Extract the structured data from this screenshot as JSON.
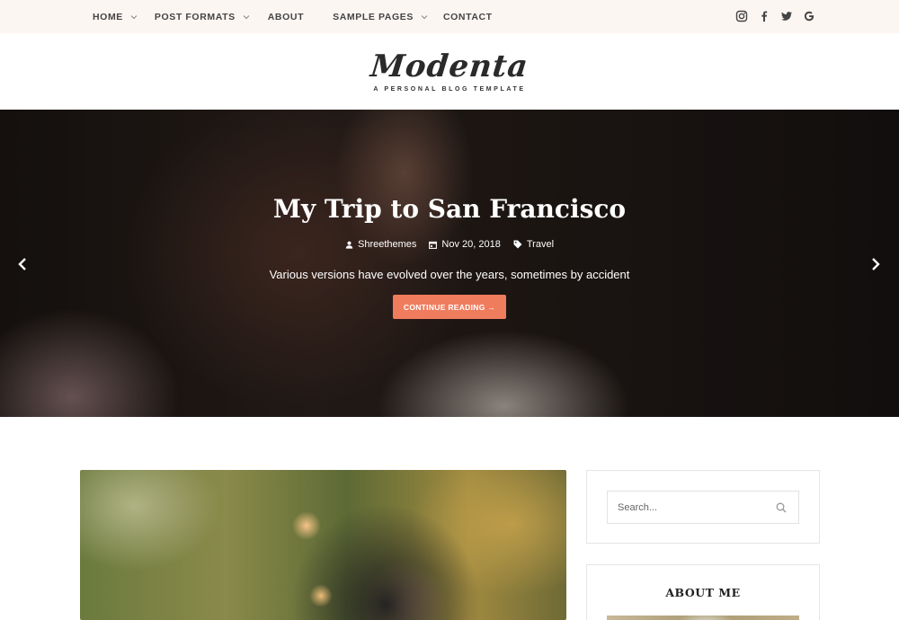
{
  "nav": {
    "items": [
      {
        "label": "HOME",
        "has_dropdown": true
      },
      {
        "label": "POST FORMATS",
        "has_dropdown": true
      },
      {
        "label": "ABOUT",
        "has_dropdown": false
      },
      {
        "label": "SAMPLE PAGES",
        "has_dropdown": true
      },
      {
        "label": "CONTACT",
        "has_dropdown": false
      }
    ],
    "social_icons": [
      "instagram-icon",
      "facebook-icon",
      "twitter-icon",
      "google-icon"
    ]
  },
  "header": {
    "logo": "Modenta",
    "tagline": "A PERSONAL BLOG TEMPLATE"
  },
  "hero": {
    "title": "My Trip to San Francisco",
    "author": "Shreethemes",
    "date": "Nov 20, 2018",
    "category": "Travel",
    "excerpt": "Various versions have evolved over the years, sometimes by accident",
    "button_label": "CONTINUE READING →"
  },
  "sidebar": {
    "search": {
      "placeholder": "Search..."
    },
    "about": {
      "title": "ABOUT ME"
    }
  },
  "colors": {
    "accent": "#f07c5e",
    "topbar_bg": "#fcf6f3"
  }
}
